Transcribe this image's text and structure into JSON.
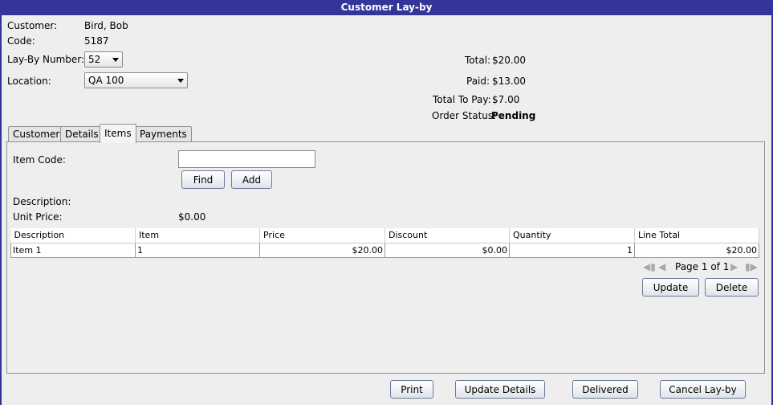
{
  "window": {
    "title": "Customer Lay-by"
  },
  "customer": {
    "customer_label": "Customer:",
    "customer_value": "Bird, Bob",
    "code_label": "Code:",
    "code_value": "5187",
    "layby_label": "Lay-By Number:",
    "layby_value": "52",
    "location_label": "Location:",
    "location_value": "QA 100"
  },
  "totals": {
    "total_label": "Total:",
    "total_value": "$20.00",
    "paid_label": "Paid:",
    "paid_value": "$13.00",
    "topay_label": "Total To Pay:",
    "topay_value": "$7.00",
    "status_label": "Order Status:",
    "status_value": "Pending"
  },
  "tabs": [
    {
      "label": "Customer"
    },
    {
      "label": "Details"
    },
    {
      "label": "Items"
    },
    {
      "label": "Payments"
    }
  ],
  "items_tab": {
    "item_code_label": "Item Code:",
    "item_code_value": "",
    "find_label": "Find",
    "add_label": "Add",
    "description_label": "Description:",
    "description_value": "",
    "unit_price_label": "Unit Price:",
    "unit_price_value": "$0.00"
  },
  "table": {
    "columns": [
      "Description",
      "Item",
      "Price",
      "Discount",
      "Quantity",
      "Line Total"
    ],
    "rows": [
      [
        "Item 1",
        "1",
        "$20.00",
        "$0.00",
        "1",
        "$20.00"
      ]
    ]
  },
  "pager": {
    "text": "Page 1 of 1"
  },
  "row_actions": {
    "update_label": "Update",
    "delete_label": "Delete"
  },
  "footer": {
    "print_label": "Print",
    "update_details_label": "Update Details",
    "delivered_label": "Delivered",
    "cancel_label": "Cancel Lay-by"
  },
  "colors": {
    "titlebar": "#33359b",
    "background": "#eeeeee"
  }
}
